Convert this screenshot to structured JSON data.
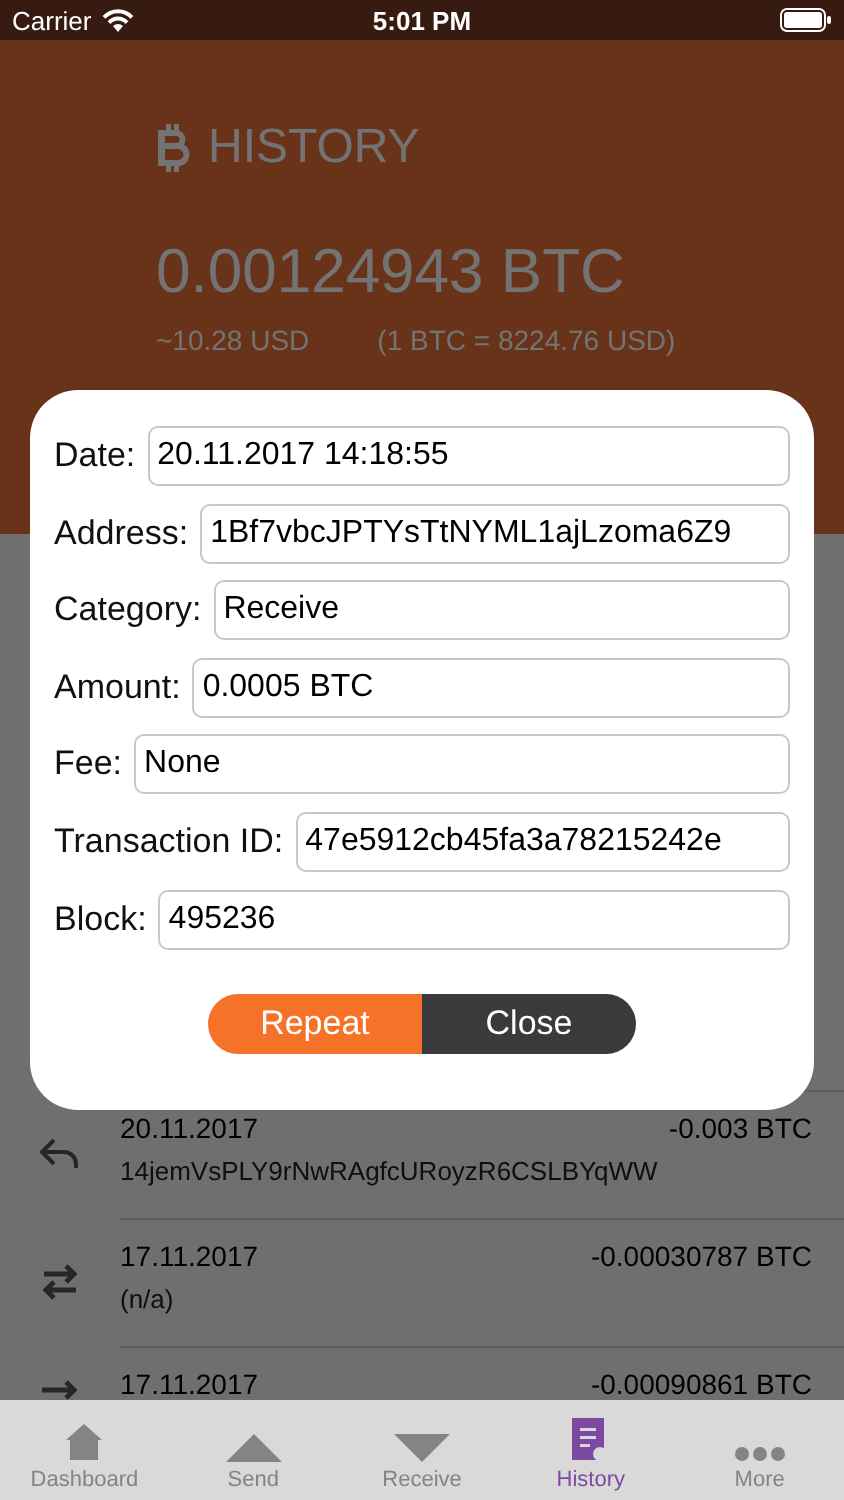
{
  "status_bar": {
    "carrier": "Carrier",
    "time": "5:01 PM"
  },
  "header": {
    "title": "HISTORY",
    "balance": "0.00124943 BTC",
    "fiat": "~10.28 USD",
    "rate": "(1 BTC = 8224.76 USD)"
  },
  "transactions": [
    {
      "kind": "reply",
      "date": "20.11.2017",
      "amount": "-0.003 BTC",
      "address": "14jemVsPLY9rNwRAgfcURoyzR6CSLBYqWW"
    },
    {
      "kind": "transfer",
      "date": "17.11.2017",
      "amount": "-0.00030787 BTC",
      "address": "(n/a)"
    },
    {
      "kind": "send",
      "date": "17.11.2017",
      "amount": "-0.00090861 BTC"
    }
  ],
  "dialog": {
    "fields": [
      {
        "label": "Date:",
        "value": "20.11.2017 14:18:55"
      },
      {
        "label": "Address:",
        "value": "1Bf7vbcJPTYsTtNYML1ajLzoma6Z9"
      },
      {
        "label": "Category:",
        "value": "Receive"
      },
      {
        "label": "Amount:",
        "value": "0.0005 BTC"
      },
      {
        "label": "Fee:",
        "value": "None"
      },
      {
        "label": "Transaction ID:",
        "value": "47e5912cb45fa3a78215242e"
      },
      {
        "label": "Block:",
        "value": "495236"
      }
    ],
    "buttons": [
      {
        "kind": "primary",
        "label": "Repeat"
      },
      {
        "kind": "secondary",
        "label": "Close"
      }
    ]
  },
  "tab_bar": [
    {
      "kind": "home",
      "label": "Dashboard",
      "selected": false
    },
    {
      "kind": "up",
      "label": "Send",
      "selected": false
    },
    {
      "kind": "down",
      "label": "Receive",
      "selected": false
    },
    {
      "kind": "history",
      "label": "History",
      "selected": true
    },
    {
      "kind": "more",
      "label": "More",
      "selected": false
    }
  ]
}
